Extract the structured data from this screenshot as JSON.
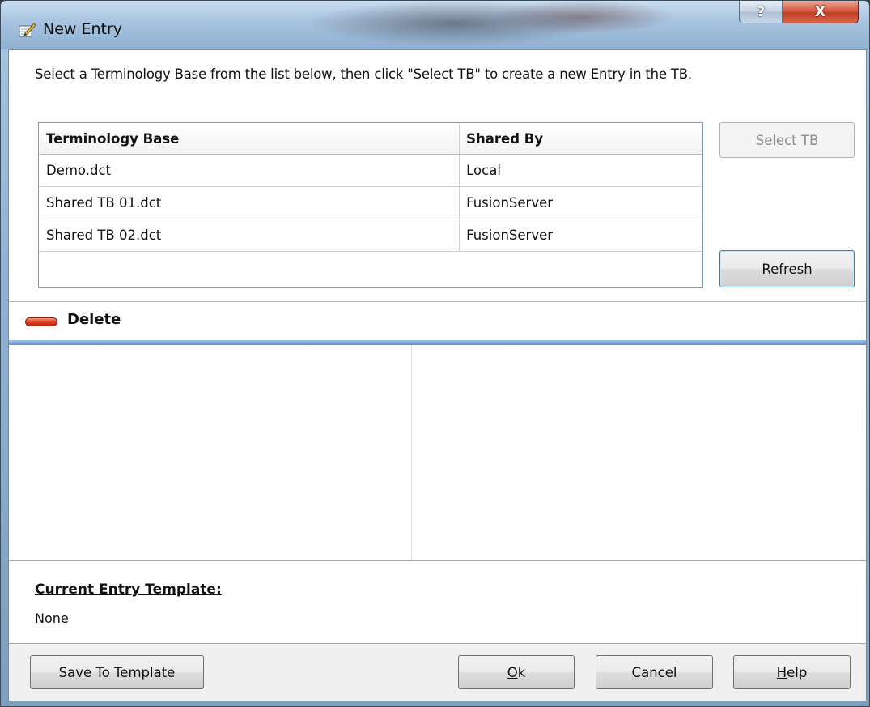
{
  "window": {
    "title": "New Entry",
    "help_glyph": "?",
    "close_glyph": "X"
  },
  "instructions": "Select a Terminology Base from the list below, then click \"Select TB\" to create a new Entry in the TB.",
  "grid": {
    "columns": [
      "Terminology Base",
      "Shared By"
    ],
    "rows": [
      [
        "Demo.dct",
        "Local"
      ],
      [
        "Shared TB 01.dct",
        "FusionServer"
      ],
      [
        "Shared TB 02.dct",
        "FusionServer"
      ]
    ]
  },
  "side_buttons": {
    "select_tb": "Select TB",
    "refresh": "Refresh"
  },
  "delete_label": "Delete",
  "template": {
    "title": "Current Entry Template:",
    "value": "None"
  },
  "footer": {
    "save_to_template": "Save To Template",
    "ok_mnemonic": "O",
    "ok_rest": "k",
    "cancel": "Cancel",
    "help_mnemonic": "H",
    "help_rest": "elp"
  },
  "colors": {
    "accent_blue": "#5b90d0",
    "delete_red": "#e0401f",
    "close_red": "#c43f24"
  },
  "icons": {
    "title": "edit-entry-icon",
    "delete": "minus-pill-icon"
  }
}
